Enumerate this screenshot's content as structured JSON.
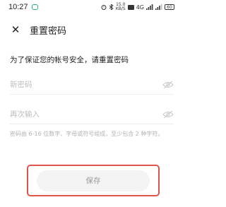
{
  "status_bar": {
    "time": "10:27",
    "speed_top": "15.0",
    "speed_bottom": "KB/S",
    "network": "4G",
    "battery": "60"
  },
  "header": {
    "close_glyph": "✕",
    "title": "重置密码"
  },
  "prompt": "为了保证您的帐号安全，请重置密码",
  "form": {
    "new_password_placeholder": "新密码",
    "confirm_password_placeholder": "再次输入",
    "hint": "密码由 6-16 位数字、字母或符号组成，至少包含 2 种字符。"
  },
  "save_label": "保存",
  "colors": {
    "highlight_border": "#e0554a",
    "button_bg": "#f4f4f4",
    "app_icon": "#2bb673"
  }
}
